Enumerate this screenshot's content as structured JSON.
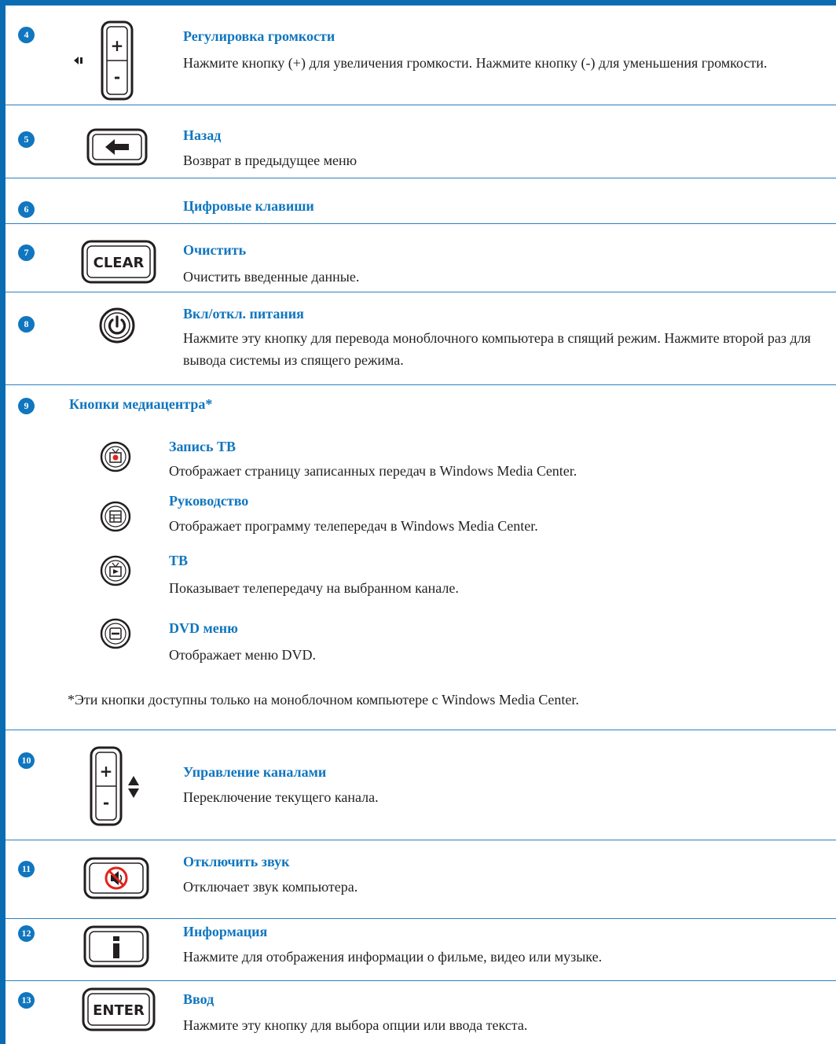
{
  "items": [
    {
      "num": "4",
      "title": "Регулировка громкости",
      "desc": "Нажмите кнопку (+) для увеличения громкости. Нажмите кнопку (-) для уменьшения громкости.",
      "icon": "volume-rocker-icon"
    },
    {
      "num": "5",
      "title": "Назад",
      "desc": "Возврат в предыдущее меню",
      "icon": "back-arrow-icon"
    },
    {
      "num": "6",
      "title": "Цифровые клавиши",
      "desc": ""
    },
    {
      "num": "7",
      "title": "Очистить",
      "desc": "Очистить введенные данные.",
      "icon_label": "CLEAR",
      "icon": "clear-button-icon"
    },
    {
      "num": "8",
      "title": "Вкл/откл. питания",
      "desc": "Нажмите эту кнопку для перевода моноблочного компьютера в спящий режим. Нажмите второй раз для вывода системы из спящего режима.",
      "icon": "power-icon"
    },
    {
      "num": "9",
      "title": "Кнопки медиацентра*",
      "subitems": [
        {
          "title": "Запись ТВ",
          "desc": "Отображает страницу записанных передач в Windows Media Center.",
          "icon": "recorded-tv-icon"
        },
        {
          "title": "Руководство",
          "desc": "Отображает программу телепередач в Windows Media Center.",
          "icon": "guide-icon"
        },
        {
          "title": "ТВ",
          "desc": "Показывает телепередачу на выбранном канале.",
          "icon": "live-tv-icon"
        },
        {
          "title": "DVD меню",
          "desc": "Отображает меню DVD.",
          "icon": "dvd-menu-icon"
        }
      ],
      "note": "*Эти кнопки доступны только на моноблочном компьютере с Windows Media Center."
    },
    {
      "num": "10",
      "title": "Управление каналами",
      "desc": "Переключение текущего канала.",
      "icon": "channel-rocker-icon"
    },
    {
      "num": "11",
      "title": "Отключить звук",
      "desc": "Отключает звук компьютера.",
      "icon": "mute-icon"
    },
    {
      "num": "12",
      "title": "Информация",
      "desc": "Нажмите для отображения информации о фильме, видео или музыке.",
      "icon": "info-icon"
    },
    {
      "num": "13",
      "title": "Ввод",
      "desc": "Нажмите эту кнопку для выбора опции или ввода текста.",
      "icon_label": "ENTER",
      "icon": "enter-button-icon"
    }
  ],
  "colors": {
    "accent": "#1076bf",
    "border": "#0a6cb3",
    "text": "#231f20"
  }
}
